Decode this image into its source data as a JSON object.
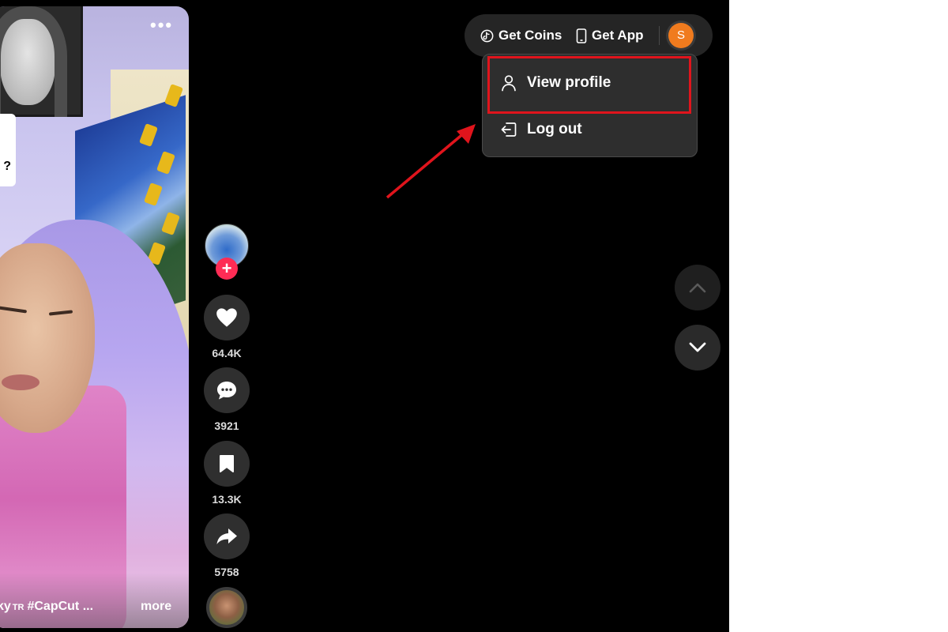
{
  "video": {
    "more_dots": "•••",
    "note_text": "?",
    "caption_prefix": "ky",
    "caption_tr": "TR",
    "caption_tag": "#CapCut",
    "caption_ellipsis": "...",
    "more_label": "more"
  },
  "actions": {
    "follow_symbol": "+",
    "likes": "64.4K",
    "comments": "3921",
    "saves": "13.3K",
    "shares": "5758"
  },
  "topbar": {
    "get_coins": "Get Coins",
    "get_app": "Get App",
    "avatar_initial": "S"
  },
  "menu": {
    "view_profile": "View profile",
    "log_out": "Log out"
  },
  "icons": {
    "coin": "coin-icon",
    "phone": "phone-icon",
    "person": "person-icon",
    "logout": "logout-icon",
    "heart": "heart-icon",
    "comment": "comment-icon",
    "bookmark": "bookmark-icon",
    "share": "share-icon",
    "chevron_up": "chevron-up-icon",
    "chevron_down": "chevron-down-icon"
  },
  "colors": {
    "background": "#000000",
    "accent_red": "#fe2c55",
    "annotation_red": "#e0141c",
    "avatar_orange": "#f07b1e",
    "menu_bg": "#2e2e2e"
  }
}
